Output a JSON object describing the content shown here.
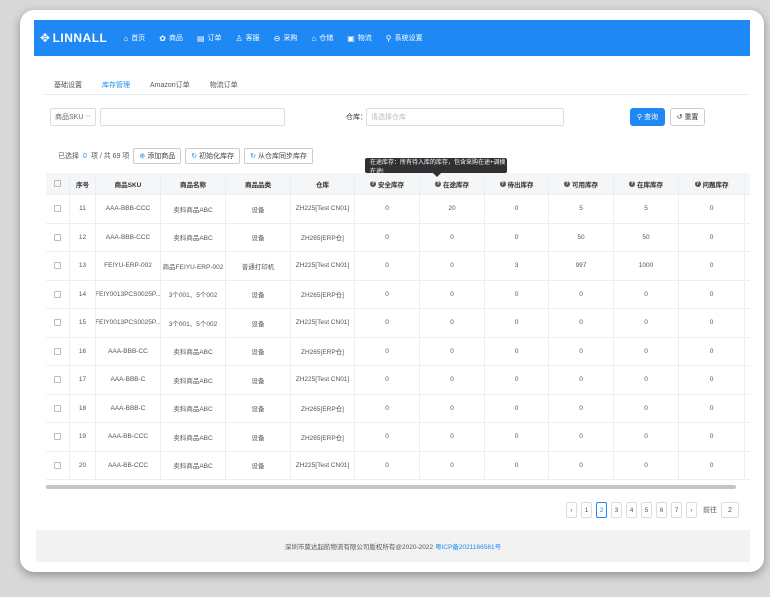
{
  "app": {
    "logo": "LINNALL"
  },
  "nav": [
    {
      "icon": "⌂",
      "label": "首页"
    },
    {
      "icon": "✿",
      "label": "商品"
    },
    {
      "icon": "▤",
      "label": "订单"
    },
    {
      "icon": "♙",
      "label": "客服"
    },
    {
      "icon": "⊖",
      "label": "采购"
    },
    {
      "icon": "⌂",
      "label": "仓储"
    },
    {
      "icon": "▣",
      "label": "物流"
    },
    {
      "icon": "⚲",
      "label": "系统设置"
    }
  ],
  "tabs": [
    "基础设置",
    "库存管理",
    "Amazon订单",
    "物流订单"
  ],
  "filters": {
    "sku_select": "商品SKU",
    "warehouse_label": "仓库",
    "warehouse_placeholder": "请选择仓库",
    "query_label": "查询",
    "reset_label": "重置"
  },
  "toolbar": {
    "selected_prefix": "已选择",
    "selected_count": "0",
    "selected_suffix": "项 / 共 69 项",
    "add_label": "添加商品",
    "init_label": "初始化库存",
    "sync_label": "从仓库同步库存"
  },
  "tooltip": "在途库存：所有待入库的库存，包含采购在途+调拨在途!",
  "columns": [
    "",
    "序号",
    "商品SKU",
    "商品名称",
    "商品品类",
    "仓库",
    "安全库存",
    "在途库存",
    "待出库存",
    "可用库存",
    "在库库存",
    "问题库存"
  ],
  "rows": [
    [
      "11",
      "AAA-BBB-CCC",
      "卖科商品ABC",
      "设备",
      "ZH225[Test CN01]",
      "0",
      "20",
      "0",
      "5",
      "5",
      "0"
    ],
    [
      "12",
      "AAA-BBB-CCC",
      "卖科商品ABC",
      "设备",
      "ZH265[ERP仓]",
      "0",
      "0",
      "0",
      "50",
      "50",
      "0"
    ],
    [
      "13",
      "FEIYU-ERP-002",
      "商品FEIYU-ERP-002",
      "普通打印机",
      "ZH225[Test CN01]",
      "0",
      "0",
      "3",
      "997",
      "1000",
      "0"
    ],
    [
      "14",
      "FEIY0013PCS0025P...",
      "3个001、5个002",
      "设备",
      "ZH265[ERP仓]",
      "0",
      "0",
      "0",
      "0",
      "0",
      "0"
    ],
    [
      "15",
      "FEIY0013PCS0025P...",
      "3个001、5个002",
      "设备",
      "ZH225[Test CN01]",
      "0",
      "0",
      "0",
      "0",
      "0",
      "0"
    ],
    [
      "16",
      "AAA-BBB-CC",
      "卖科商品ABC",
      "设备",
      "ZH265[ERP仓]",
      "0",
      "0",
      "0",
      "0",
      "0",
      "0"
    ],
    [
      "17",
      "AAA-BBB-C",
      "卖科商品ABC",
      "设备",
      "ZH225[Test CN01]",
      "0",
      "0",
      "0",
      "0",
      "0",
      "0"
    ],
    [
      "18",
      "AAA-BBB-C",
      "卖科商品ABC",
      "设备",
      "ZH265[ERP仓]",
      "0",
      "0",
      "0",
      "0",
      "0",
      "0"
    ],
    [
      "19",
      "AAA-BB-CCC",
      "卖科商品ABC",
      "设备",
      "ZH265[ERP仓]",
      "0",
      "0",
      "0",
      "0",
      "0",
      "0"
    ],
    [
      "20",
      "AAA-BB-CCC",
      "卖科商品ABC",
      "设备",
      "ZH225[Test CN01]",
      "0",
      "0",
      "0",
      "0",
      "0",
      "0"
    ]
  ],
  "pagination": {
    "prev": "‹",
    "pages": [
      "1",
      "2",
      "3",
      "4",
      "5",
      "6",
      "7"
    ],
    "active": "2",
    "next": "›",
    "goto_label": "前往",
    "goto_value": "2"
  },
  "footer": {
    "copyright": "深圳市莫达起航物流有限公司版权所有@2020-2022",
    "icp": "粤ICP备2021166581号"
  },
  "colors": {
    "primary": "#1e88f5"
  }
}
